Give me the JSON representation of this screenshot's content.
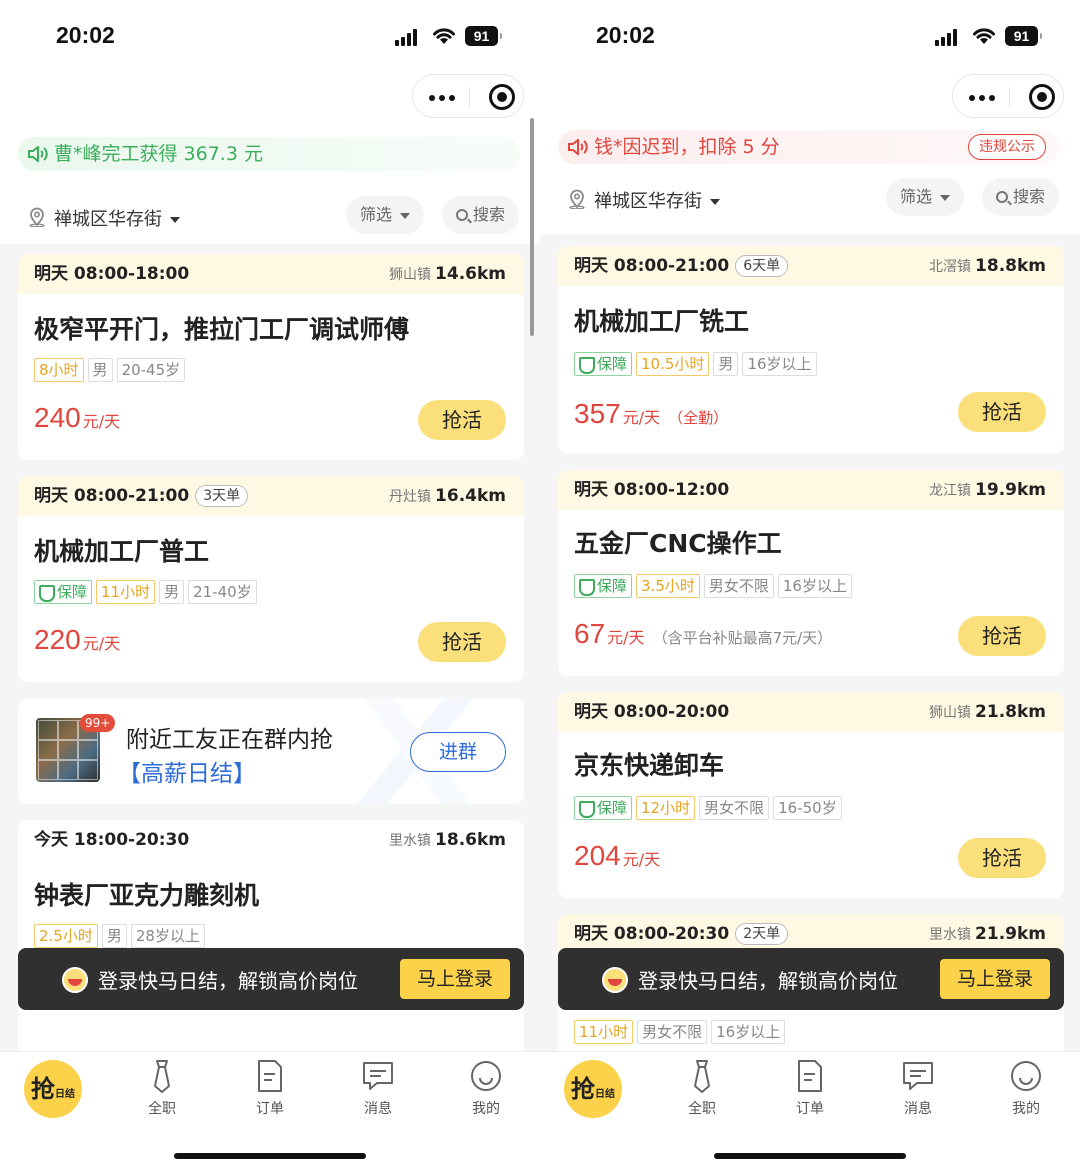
{
  "left": {
    "status": {
      "time": "20:02",
      "battery": "91"
    },
    "notice": "曹*峰完工获得 367.3 元",
    "location": "禅城区华存街",
    "filter_label": "筛选",
    "search_label": "搜索",
    "jobs": [
      {
        "time": "明天 08:00-18:00",
        "badge": "",
        "town": "狮山镇",
        "distance": "14.6km",
        "title": "极窄平开门，推拉门工厂调试师傅",
        "tags": [
          "8小时",
          "男",
          "20-45岁"
        ],
        "price": "240",
        "unit": "元/天",
        "note": "",
        "button": "抢活"
      },
      {
        "time": "明天 08:00-21:00",
        "badge": "3天单",
        "town": "丹灶镇",
        "distance": "16.4km",
        "title": "机械加工厂普工",
        "tags": [
          "保障",
          "11小时",
          "男",
          "21-40岁"
        ],
        "price": "220",
        "unit": "元/天",
        "note": "",
        "button": "抢活"
      },
      {
        "time": "今天 18:00-20:30",
        "badge": "",
        "town": "里水镇",
        "distance": "18.6km",
        "title": "钟表厂亚克力雕刻机",
        "tags": [
          "2.5小时",
          "男",
          "28岁以上"
        ]
      }
    ],
    "promo": {
      "line1": "附近工友正在群内抢",
      "line2": "【高薪日结】",
      "count": "99+",
      "button": "进群"
    },
    "toast": {
      "message": "登录快马日结，解锁高价岗位",
      "button": "马上登录"
    }
  },
  "right": {
    "status": {
      "time": "20:02",
      "battery": "91"
    },
    "notice": "钱*因迟到，扣除 5 分",
    "notice_button": "违规公示",
    "location": "禅城区华存街",
    "filter_label": "筛选",
    "search_label": "搜索",
    "jobs": [
      {
        "time": "明天 08:00-21:00",
        "badge": "6天单",
        "town": "北滘镇",
        "distance": "18.8km",
        "title": "机械加工厂铣工",
        "tags": [
          "保障",
          "10.5小时",
          "男",
          "16岁以上"
        ],
        "price": "357",
        "unit": "元/天",
        "note": "（全勤）",
        "button": "抢活"
      },
      {
        "time": "明天 08:00-12:00",
        "badge": "",
        "town": "龙江镇",
        "distance": "19.9km",
        "title": "五金厂CNC操作工",
        "tags": [
          "保障",
          "3.5小时",
          "男女不限",
          "16岁以上"
        ],
        "price": "67",
        "unit": "元/天",
        "note": "（含平台补贴最高7元/天）",
        "button": "抢活"
      },
      {
        "time": "明天 08:00-20:00",
        "badge": "",
        "town": "狮山镇",
        "distance": "21.8km",
        "title": "京东快递卸车",
        "tags": [
          "保障",
          "12小时",
          "男女不限",
          "16-50岁"
        ],
        "price": "204",
        "unit": "元/天",
        "note": "",
        "button": "抢活"
      },
      {
        "time": "明天 08:00-20:30",
        "badge": "2天单",
        "town": "里水镇",
        "distance": "21.9km",
        "title": "",
        "tags": [
          "11小时",
          "男女不限",
          "16岁以上"
        ]
      }
    ],
    "toast": {
      "message": "登录快马日结，解锁高价岗位",
      "button": "马上登录"
    }
  },
  "tabbar": {
    "main": "抢",
    "main_small": "日结",
    "items": [
      "全职",
      "订单",
      "消息",
      "我的"
    ]
  },
  "colors": {
    "accent_yellow": "#fbdf7b",
    "price_red": "#e0453e",
    "guard_green": "#3cab5c",
    "link_blue": "#2f6cd8"
  }
}
